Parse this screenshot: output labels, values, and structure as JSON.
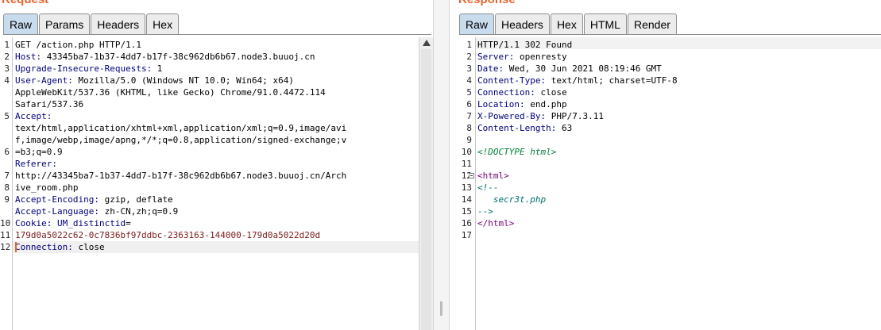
{
  "request": {
    "title": "Request",
    "tabs": [
      "Raw",
      "Params",
      "Headers",
      "Hex"
    ],
    "active_tab": "Raw",
    "line_numbers": [
      "1",
      "2",
      "3",
      "4",
      "",
      "",
      "5",
      "",
      "",
      "6",
      "",
      "7",
      "8",
      "9",
      "",
      "10",
      "11",
      "12"
    ],
    "rows": [
      [
        {
          "t": "GET /action.php HTTP/1.1",
          "c": "v"
        }
      ],
      [
        {
          "t": "Host:",
          "c": "k"
        },
        {
          "t": " 43345ba7-1b37-4dd7-b17f-38c962db6b67.node3.buuoj.cn",
          "c": "v"
        }
      ],
      [
        {
          "t": "Upgrade-Insecure-Requests:",
          "c": "k"
        },
        {
          "t": " 1",
          "c": "v"
        }
      ],
      [
        {
          "t": "User-Agent:",
          "c": "k"
        },
        {
          "t": " Mozilla/5.0 (Windows NT 10.0; Win64; x64)",
          "c": "v"
        }
      ],
      [
        {
          "t": "AppleWebKit/537.36 (KHTML, like Gecko) Chrome/91.0.4472.114",
          "c": "v"
        }
      ],
      [
        {
          "t": "Safari/537.36",
          "c": "v"
        }
      ],
      [
        {
          "t": "Accept:",
          "c": "k"
        }
      ],
      [
        {
          "t": "text/html,application/xhtml+xml,application/xml;q=0.9,image/avi",
          "c": "v"
        }
      ],
      [
        {
          "t": "f,image/webp,image/apng,*/*;q=0.8,application/signed-exchange;v",
          "c": "v"
        }
      ],
      [
        {
          "t": "=b3;q=0.9",
          "c": "v"
        }
      ],
      [
        {
          "t": "Referer:",
          "c": "k"
        }
      ],
      [
        {
          "t": "http://43345ba7-1b37-4dd7-b17f-38c962db6b67.node3.buuoj.cn/Arch",
          "c": "v"
        }
      ],
      [
        {
          "t": "ive_room.php",
          "c": "v"
        }
      ],
      [
        {
          "t": "Accept-Encoding:",
          "c": "k"
        },
        {
          "t": " gzip, deflate",
          "c": "v"
        }
      ],
      [
        {
          "t": "Accept-Language:",
          "c": "k"
        },
        {
          "t": " zh-CN,zh;q=0.9",
          "c": "v"
        }
      ],
      [
        {
          "t": "Cookie:",
          "c": "k"
        },
        {
          "t": " ",
          "c": "v"
        },
        {
          "t": "UM_distinctid",
          "c": "k"
        },
        {
          "t": "=",
          "c": "v"
        }
      ],
      [
        {
          "t": "179d0a5022c62-0c7836bf97ddbc-2363163-144000-179d0a5022d20d",
          "c": "ck"
        }
      ],
      [
        {
          "t": "Connection:",
          "c": "k"
        },
        {
          "t": " close",
          "c": "v"
        }
      ],
      [
        {
          "t": "",
          "c": "v"
        }
      ],
      [
        {
          "t": "",
          "c": "v"
        }
      ]
    ]
  },
  "response": {
    "title": "Response",
    "tabs": [
      "Raw",
      "Headers",
      "Hex",
      "HTML",
      "Render"
    ],
    "active_tab": "Raw",
    "line_numbers": [
      "1",
      "2",
      "3",
      "4",
      "5",
      "6",
      "7",
      "8",
      "9",
      "10",
      "11",
      "12",
      "13",
      "14",
      "15",
      "16",
      "17"
    ],
    "rows": [
      [
        {
          "t": "HTTP/1.1 302 Found",
          "c": "v"
        }
      ],
      [
        {
          "t": "Server:",
          "c": "k"
        },
        {
          "t": " openresty",
          "c": "v"
        }
      ],
      [
        {
          "t": "Date:",
          "c": "k"
        },
        {
          "t": " Wed, 30 Jun 2021 08:19:46 GMT",
          "c": "v"
        }
      ],
      [
        {
          "t": "Content-Type:",
          "c": "k"
        },
        {
          "t": " text/html; charset=UTF-8",
          "c": "v"
        }
      ],
      [
        {
          "t": "Connection:",
          "c": "k"
        },
        {
          "t": " close",
          "c": "v"
        }
      ],
      [
        {
          "t": "Location:",
          "c": "k"
        },
        {
          "t": " end.php",
          "c": "v"
        }
      ],
      [
        {
          "t": "X-Powered-By:",
          "c": "k"
        },
        {
          "t": " PHP/7.3.11",
          "c": "v"
        }
      ],
      [
        {
          "t": "Content-Length:",
          "c": "k"
        },
        {
          "t": " 63",
          "c": "v"
        }
      ],
      [
        {
          "t": "",
          "c": "v"
        }
      ],
      [
        {
          "t": "<!DOCTYPE html>",
          "c": "kw-doc"
        }
      ],
      [
        {
          "t": "",
          "c": "v"
        }
      ],
      [
        {
          "t": "<html>",
          "c": "tag"
        }
      ],
      [
        {
          "t": "<!--",
          "c": "cmt"
        }
      ],
      [
        {
          "t": "   secr3t.php",
          "c": "cmt"
        }
      ],
      [
        {
          "t": "-->",
          "c": "cmt"
        }
      ],
      [
        {
          "t": "</html>",
          "c": "tag"
        }
      ],
      [
        {
          "t": "",
          "c": "v"
        }
      ]
    ]
  },
  "colors": {
    "accent": "#e8642c",
    "active_tab": "#c9dcee",
    "header_key": "#00007a",
    "cookie_value": "#7a1b1b"
  },
  "icons": [
    "scroll-up-arrow-icon",
    "fold-toggle-icon"
  ]
}
